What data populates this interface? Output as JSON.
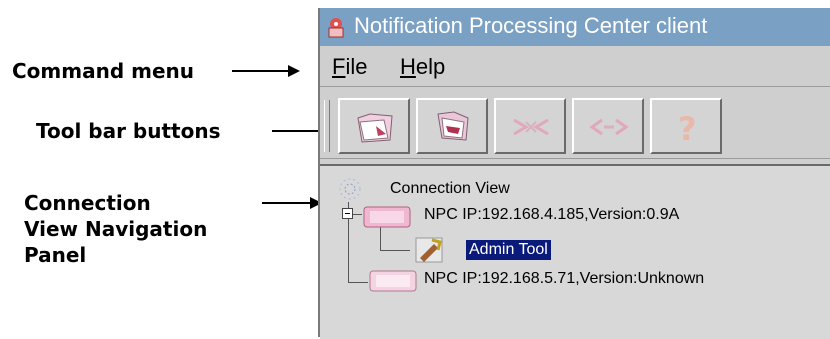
{
  "annotations": {
    "command_menu": "Command menu",
    "toolbar_buttons": "Tool bar buttons",
    "connection_view_line1": "Connection",
    "connection_view_line2": "View Navigation",
    "connection_view_line3": "Panel"
  },
  "window": {
    "title": "Notification Processing Center client",
    "app_icon": "npc-app-icon"
  },
  "menu": {
    "items": [
      {
        "label": "File",
        "mnemonic": "F"
      },
      {
        "label": "Help",
        "mnemonic": "H"
      }
    ]
  },
  "toolbar": {
    "buttons": [
      {
        "icon": "open-folder-icon",
        "enabled": true
      },
      {
        "icon": "folder-stack-icon",
        "enabled": true
      },
      {
        "icon": "disconnect-icon",
        "enabled": false
      },
      {
        "icon": "connect-icon",
        "enabled": false
      },
      {
        "icon": "help-question-icon",
        "enabled": false
      }
    ]
  },
  "tree": {
    "root_label": "Connection View",
    "nodes": [
      {
        "label": "NPC IP:192.168.4.185,Version:0.9A",
        "expanded": true,
        "children": [
          {
            "label": "Admin Tool",
            "selected": true
          }
        ]
      },
      {
        "label": "NPC IP:192.168.5.71,Version:Unknown",
        "expanded": false
      }
    ]
  },
  "colors": {
    "titlebar": "#7aa0c4",
    "selection": "#0a1a7a",
    "node_icon": "#e8a0c0"
  }
}
